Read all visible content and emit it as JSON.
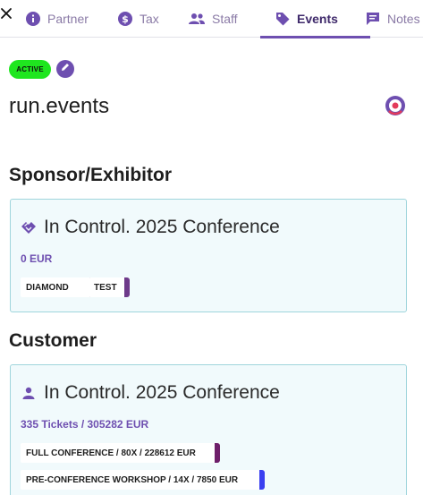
{
  "window": {
    "close_label": "×"
  },
  "tabs": [
    {
      "id": "partner",
      "label": "Partner",
      "icon": "info-icon",
      "active": false
    },
    {
      "id": "tax",
      "label": "Tax",
      "icon": "dollar-icon",
      "active": false
    },
    {
      "id": "staff",
      "label": "Staff",
      "icon": "people-icon",
      "active": false
    },
    {
      "id": "events",
      "label": "Events",
      "icon": "tag-icon",
      "active": true
    },
    {
      "id": "notes",
      "label": "Notes",
      "icon": "comment-icon",
      "active": false
    }
  ],
  "header": {
    "status_badge": "ACTIVE",
    "title": "run.events",
    "status_indicator_icon": "target-icon"
  },
  "sponsor_section": {
    "title": "Sponsor/Exhibitor",
    "card": {
      "icon": "handshake-icon",
      "event_name": "In Control. 2025 Conference",
      "amount": "0 EUR",
      "chips": [
        {
          "label": "DIAMOND",
          "color": "#6e3a8a"
        },
        {
          "label": "TEST",
          "color": "#6e3a8a"
        }
      ]
    }
  },
  "customer_section": {
    "title": "Customer",
    "card": {
      "icon": "person-icon",
      "event_name": "In Control. 2025 Conference",
      "summary": "335 Tickets / 305282 EUR",
      "chips": [
        {
          "label": "FULL CONFERENCE / 80X / 228612 EUR",
          "color": "#6e1f6a"
        },
        {
          "label": "PRE-CONFERENCE WORKSHOP / 14X / 7850 EUR",
          "color": "#3a3ff0"
        }
      ]
    }
  },
  "colors": {
    "accent": "#6e4fb0",
    "active_badge": "#1fe61f",
    "card_bg": "#f1fafc",
    "card_border": "#9fd5dc"
  }
}
